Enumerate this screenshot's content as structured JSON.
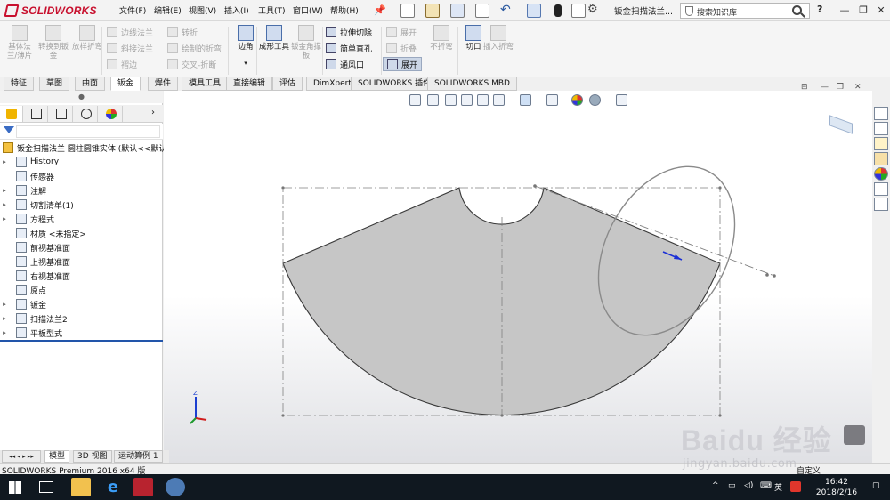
{
  "app": {
    "brand": "SOLIDWORKS",
    "document_title": "钣金扫描法兰...",
    "search_placeholder": "搜索知识库"
  },
  "menu": [
    "文件(F)",
    "编辑(E)",
    "视图(V)",
    "插入(I)",
    "工具(T)",
    "窗口(W)",
    "帮助(H)"
  ],
  "ribbon": {
    "base_flange": "基体法兰/薄片",
    "convert_to_sheet": "转换到钣金",
    "lofted_bend": "放样折弯",
    "edge_flange": "边线法兰",
    "miter_flange": "斜接法兰",
    "hem": "褶边",
    "jog": "转折",
    "sketched_bend": "绘制的折弯",
    "cross_break": "交叉-折断",
    "corners": "边角",
    "forming_tool": "成形工具",
    "sheet_gusset": "钣金角撑板",
    "extruded_cut": "拉伸切除",
    "simple_hole": "简单直孔",
    "vent": "通风口",
    "unfold": "展开",
    "fold": "折叠",
    "no_bends": "不折弯",
    "flatten": "展开",
    "rip": "切口",
    "insert_bends": "插入折弯"
  },
  "tabs": [
    "特征",
    "草图",
    "曲面",
    "钣金",
    "焊件",
    "模具工具",
    "直接编辑",
    "评估",
    "DimXpert",
    "SOLIDWORKS 插件",
    "SOLIDWORKS MBD"
  ],
  "active_tab": "钣金",
  "tree": {
    "root": "钣金扫描法兰 圆柱圆锥实体 (默认<<默认",
    "items": [
      {
        "label": "History",
        "expandable": true
      },
      {
        "label": "传感器",
        "expandable": false
      },
      {
        "label": "注解",
        "expandable": true
      },
      {
        "label": "切割清单(1)",
        "expandable": true
      },
      {
        "label": "方程式",
        "expandable": true
      },
      {
        "label": "材质 <未指定>",
        "expandable": false
      },
      {
        "label": "前视基准面",
        "expandable": false
      },
      {
        "label": "上视基准面",
        "expandable": false
      },
      {
        "label": "右视基准面",
        "expandable": false
      },
      {
        "label": "原点",
        "expandable": false
      },
      {
        "label": "钣金",
        "expandable": true
      },
      {
        "label": "扫描法兰2",
        "expandable": true
      },
      {
        "label": "平板型式",
        "expandable": true
      }
    ]
  },
  "bottom_tabs": [
    "模型",
    "3D 视图",
    "运动算例 1"
  ],
  "active_bottom_tab": "模型",
  "status": {
    "left": "SOLIDWORKS Premium 2016 x64 版",
    "right": "自定义"
  },
  "taskbar": {
    "ime": "英",
    "time": "16:42",
    "date": "2018/2/16"
  },
  "watermark": {
    "brand": "Baidu 经验",
    "url": "jingyan.baidu.com"
  },
  "triad": {
    "z_label": "Z"
  },
  "colors": {
    "brand_red": "#c8102e",
    "part_fill": "#c6c6c6",
    "sketch_line": "#7f7f7f",
    "taskbar": "#101820"
  }
}
